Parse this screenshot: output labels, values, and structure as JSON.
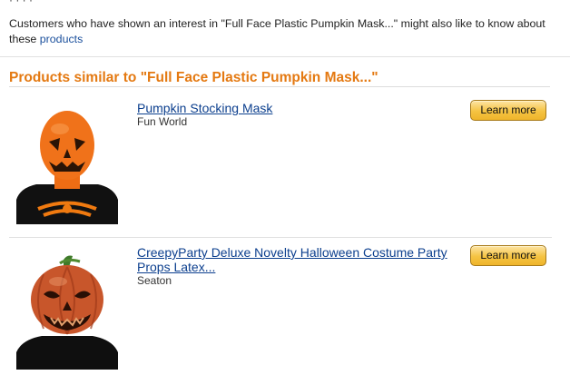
{
  "header": {
    "cut_text": "·  ·  ·  ·",
    "intro_text": "Customers who have shown an interest in \"Full Face Plastic Pumpkin Mask...\" might also like to know about these",
    "intro_link": "products",
    "section_title": "Products similar to \"Full Face Plastic Pumpkin Mask...\""
  },
  "products": [
    {
      "title": "Pumpkin Stocking Mask",
      "brand": "Fun World",
      "button_label": "Learn more",
      "image_icon": "pumpkin-stocking-mask-photo"
    },
    {
      "title": "CreepyParty Deluxe Novelty Halloween Costume Party Props Latex...",
      "brand": "Seaton",
      "button_label": "Learn more",
      "image_icon": "pumpkin-head-mask-photo"
    }
  ],
  "colors": {
    "accent": "#e47911",
    "link": "#0c3f8e",
    "button": "#f5c342"
  }
}
